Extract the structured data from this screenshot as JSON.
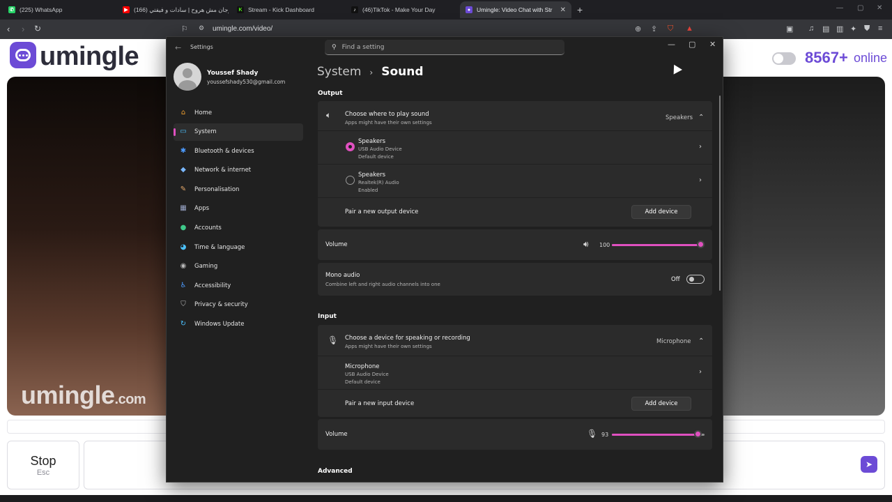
{
  "browser": {
    "tabs": [
      {
        "label": "(225) WhatsApp",
        "color": "#25d366"
      },
      {
        "label": "(166) مهرجان مش هروح | سادات و فيفتي",
        "color": "#ff0000"
      },
      {
        "label": "Stream - Kick Dashboard",
        "color": "#53fc18"
      },
      {
        "label": "(46)TikTok - Make Your Day",
        "color": "#ffffff"
      },
      {
        "label": "Umingle: Video Chat with Str",
        "color": "#6c4bd6"
      }
    ],
    "url": "umingle.com/video/"
  },
  "site": {
    "logo_text": "umingle",
    "online_count": "8567+",
    "online_word": "online",
    "watermark_main": "umingle",
    "watermark_suffix": ".com",
    "stop_label": "Stop",
    "stop_sub": "Esc",
    "accent": "#6c4bd6"
  },
  "settings": {
    "app_title": "Settings",
    "search_placeholder": "Find a setting",
    "profile": {
      "name": "Youssef Shady",
      "email": "youssefshady530@gmail.com"
    },
    "nav": [
      {
        "label": "Home",
        "icon": "home-icon",
        "glyph": "⌂",
        "color": "#f0a030"
      },
      {
        "label": "System",
        "icon": "system-icon",
        "glyph": "▭",
        "color": "#4cc2ff",
        "active": true
      },
      {
        "label": "Bluetooth & devices",
        "icon": "bluetooth-icon",
        "glyph": "✱",
        "color": "#4c9bff"
      },
      {
        "label": "Network & internet",
        "icon": "network-icon",
        "glyph": "◆",
        "color": "#7ab8ff"
      },
      {
        "label": "Personalisation",
        "icon": "brush-icon",
        "glyph": "✎",
        "color": "#e6a96a"
      },
      {
        "label": "Apps",
        "icon": "apps-icon",
        "glyph": "▦",
        "color": "#9aa6c8"
      },
      {
        "label": "Accounts",
        "icon": "accounts-icon",
        "glyph": "●",
        "color": "#3fc98a"
      },
      {
        "label": "Time & language",
        "icon": "globe-icon",
        "glyph": "◕",
        "color": "#4cc2ff"
      },
      {
        "label": "Gaming",
        "icon": "gamepad-icon",
        "glyph": "◉",
        "color": "#b8b8b8"
      },
      {
        "label": "Accessibility",
        "icon": "accessibility-icon",
        "glyph": "♿",
        "color": "#4c9bff"
      },
      {
        "label": "Privacy & security",
        "icon": "shield-icon",
        "glyph": "⛉",
        "color": "#b8b8b8"
      },
      {
        "label": "Windows Update",
        "icon": "update-icon",
        "glyph": "↻",
        "color": "#4cc2ff"
      }
    ],
    "breadcrumb": {
      "parent": "System",
      "current": "Sound"
    },
    "output": {
      "section": "Output",
      "choose_title": "Choose where to play sound",
      "choose_sub": "Apps might have their own settings",
      "choose_value": "Speakers",
      "devices": [
        {
          "name": "Speakers",
          "line1": "USB Audio Device",
          "line2": "Default device",
          "selected": true
        },
        {
          "name": "Speakers",
          "line1": "Realtek(R) Audio",
          "line2": "Enabled",
          "selected": false
        }
      ],
      "pair_label": "Pair a new output device",
      "add_label": "Add device",
      "volume_label": "Volume",
      "volume_value": "100",
      "volume_fraction": 1.0,
      "mono_title": "Mono audio",
      "mono_sub": "Combine left and right audio channels into one",
      "mono_state": "Off"
    },
    "input": {
      "section": "Input",
      "choose_title": "Choose a device for speaking or recording",
      "choose_sub": "Apps might have their own settings",
      "choose_value": "Microphone",
      "device": {
        "name": "Microphone",
        "line1": "USB Audio Device",
        "line2": "Default device"
      },
      "pair_label": "Pair a new input device",
      "add_label": "Add device",
      "volume_label": "Volume",
      "volume_value": "93",
      "volume_fraction": 0.93
    },
    "advanced_section": "Advanced",
    "accent": "#e050c0"
  }
}
